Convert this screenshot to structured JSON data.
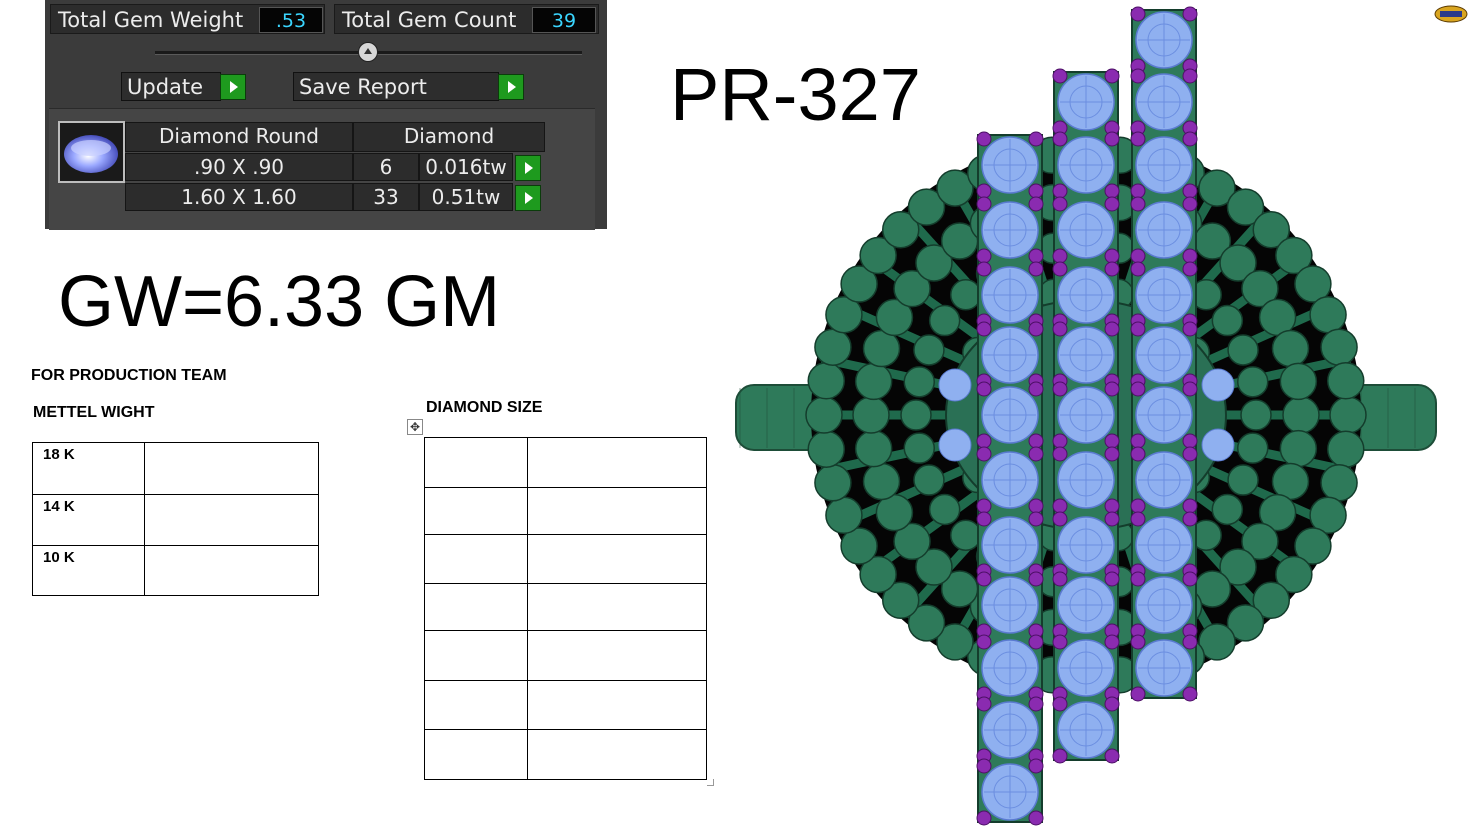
{
  "report": {
    "total_weight_label": "Total Gem Weight",
    "total_weight_value": ".53",
    "total_count_label": "Total Gem Count",
    "total_count_value": "39",
    "update_label": "Update",
    "save_report_label": "Save Report",
    "header_shape": "Diamond Round",
    "header_material": "Diamond",
    "rows": [
      {
        "size": ".90 X .90",
        "count": "6",
        "weight": "0.016tw"
      },
      {
        "size": "1.60 X 1.60",
        "count": "33",
        "weight": "0.51tw"
      }
    ]
  },
  "gross_weight": "GW=6.33 GM",
  "model_code": "PR-327",
  "production": {
    "title": "FOR PRODUCTION TEAM",
    "metal_weight_title": "METTEL WIGHT",
    "karats": [
      "18 K",
      "14 K",
      "10 K"
    ]
  },
  "diamond_size_title": "DIAMOND SIZE",
  "colors": {
    "panel_bg": "#3b3b3b",
    "value_text": "#3ad6ff",
    "play_green": "#1e9a1e",
    "metal_green": "#2e7a5a",
    "stone_blue": "#8fb0f0",
    "prong_purple": "#8a2bb0"
  }
}
